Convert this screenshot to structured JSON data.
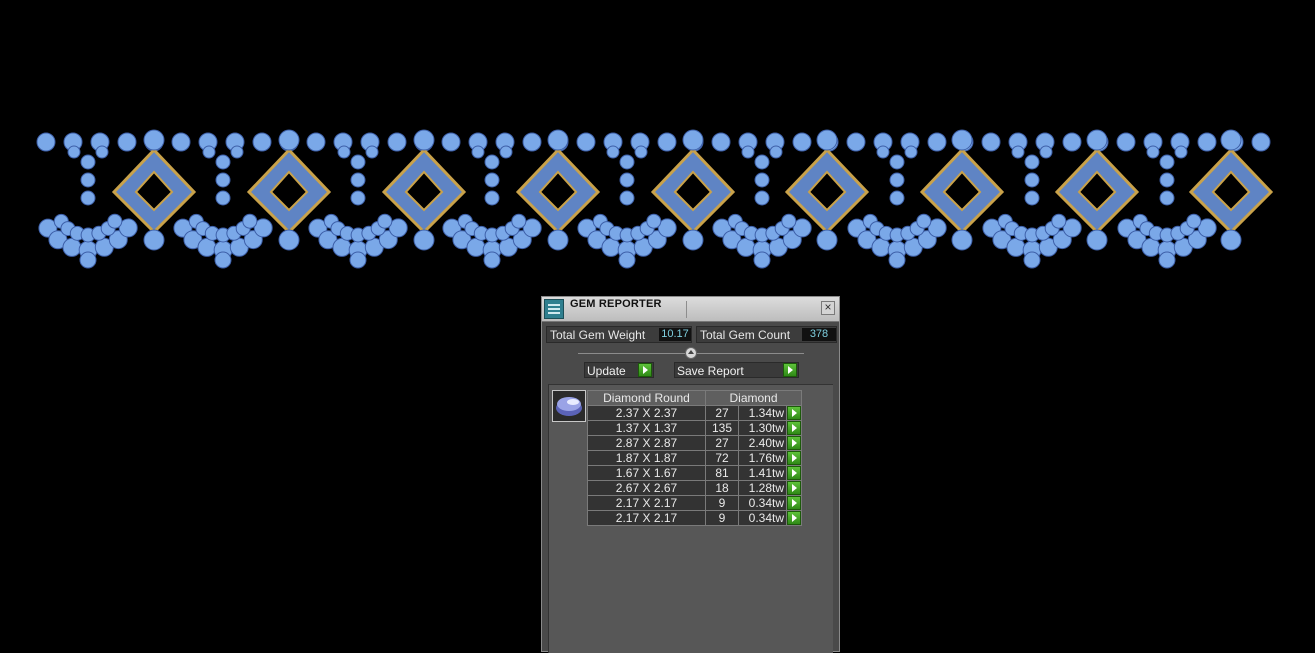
{
  "colors": {
    "background": "#000000",
    "gem_blue": "#7aa8e8",
    "gold": "#c9a24a",
    "panel": "#4a4a4a",
    "value_text": "#7fd0e0"
  },
  "gem_reporter": {
    "title": "GEM REPORTER",
    "close_icon": "close-icon",
    "total_weight_label": "Total Gem Weight",
    "total_weight_value": "10.17",
    "total_count_label": "Total Gem Count",
    "total_count_value": "378",
    "update_label": "Update",
    "save_report_label": "Save Report",
    "table": {
      "headers": [
        "Diamond Round",
        "Diamond"
      ],
      "rows": [
        {
          "size": "2.37 X 2.37",
          "count": "27",
          "weight": "1.34tw"
        },
        {
          "size": "1.37 X 1.37",
          "count": "135",
          "weight": "1.30tw"
        },
        {
          "size": "2.87 X 2.87",
          "count": "27",
          "weight": "2.40tw"
        },
        {
          "size": "1.87 X 1.87",
          "count": "72",
          "weight": "1.76tw"
        },
        {
          "size": "1.67 X 1.67",
          "count": "81",
          "weight": "1.41tw"
        },
        {
          "size": "2.67 X 2.67",
          "count": "18",
          "weight": "1.28tw"
        },
        {
          "size": "2.17 X 2.17",
          "count": "9",
          "weight": "0.34tw"
        },
        {
          "size": "2.17 X 2.17",
          "count": "9",
          "weight": "0.34tw"
        }
      ]
    }
  }
}
